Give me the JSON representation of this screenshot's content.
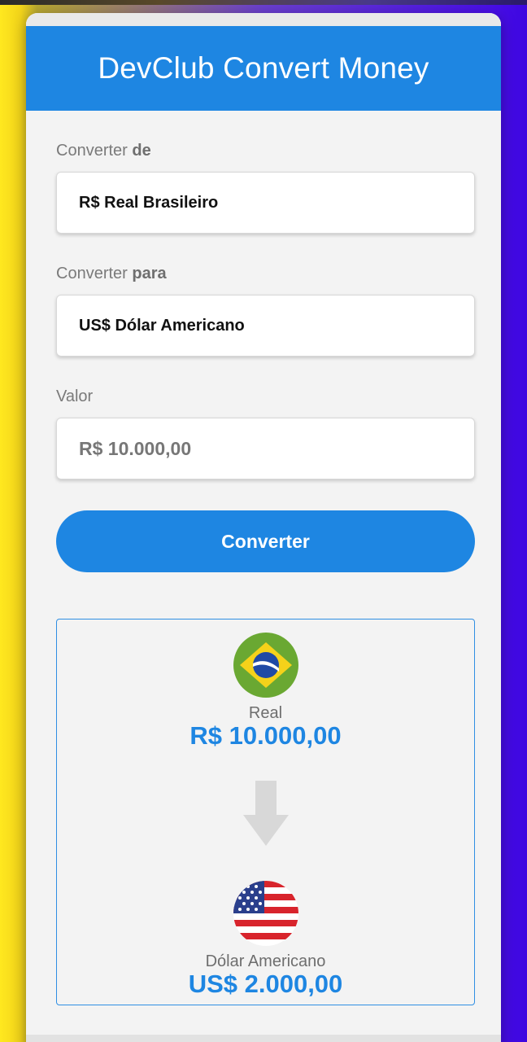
{
  "app": {
    "title": "DevClub Convert Money"
  },
  "colors": {
    "primary": "#1e86e2"
  },
  "form": {
    "from_label_prefix": "Converter ",
    "from_label_bold": "de",
    "from_value": "R$ Real Brasileiro",
    "to_label_prefix": "Converter ",
    "to_label_bold": "para",
    "to_value": "US$ Dólar Americano",
    "amount_label": "Valor",
    "amount_value": "R$ 10.000,00",
    "convert_button": "Converter"
  },
  "result": {
    "from": {
      "flag_icon": "brazil-flag-icon",
      "name": "Real",
      "value": "R$ 10.000,00"
    },
    "arrow_icon": "arrow-down-icon",
    "to": {
      "flag_icon": "usa-flag-icon",
      "name": "Dólar Americano",
      "value": "US$ 2.000,00"
    }
  }
}
